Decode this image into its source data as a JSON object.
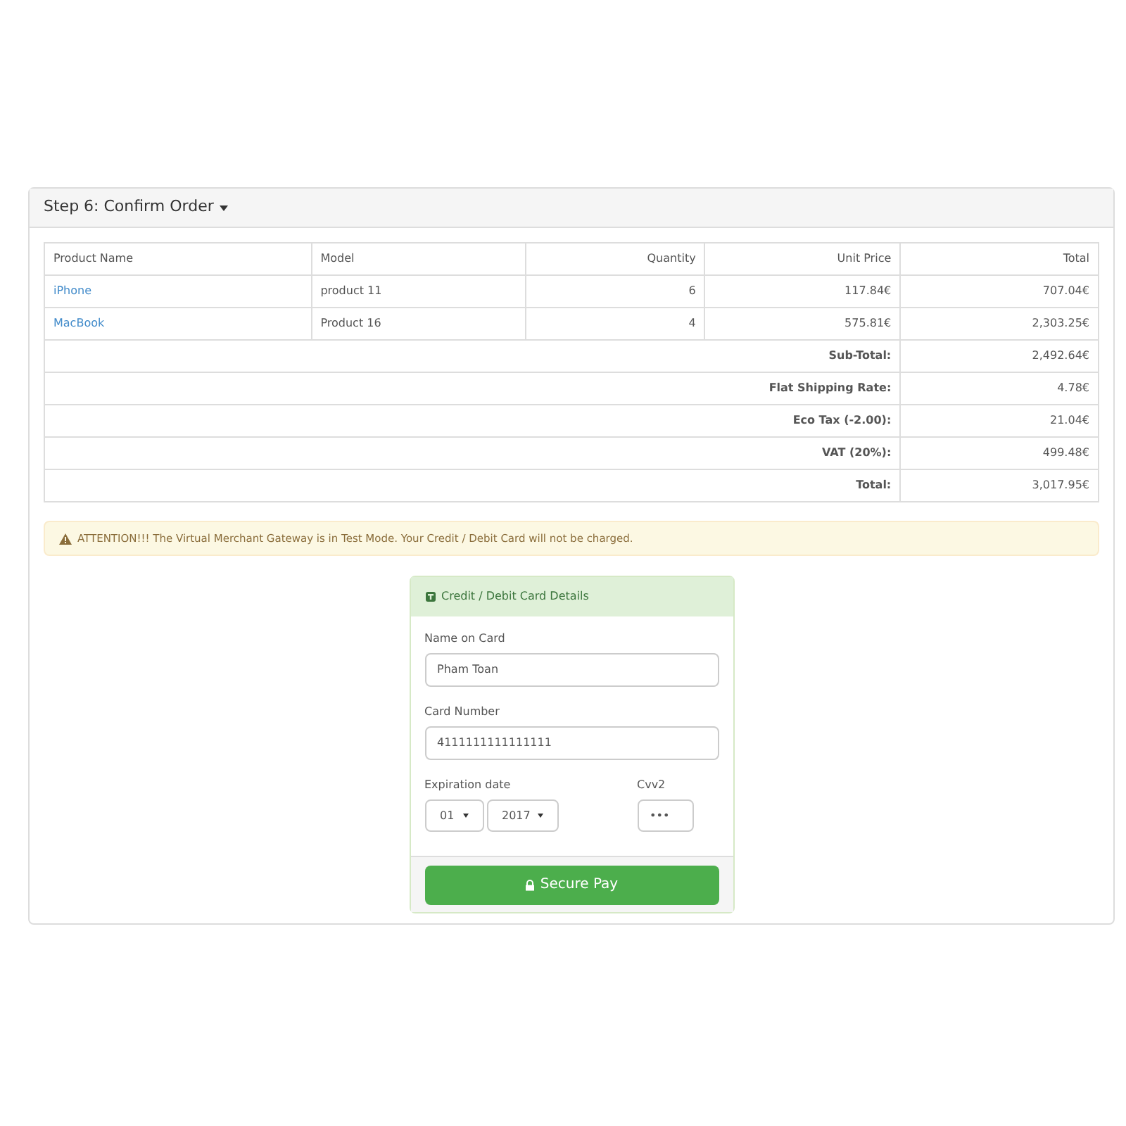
{
  "panel": {
    "title": "Step 6: Confirm Order"
  },
  "table": {
    "columns": [
      "Product Name",
      "Model",
      "Quantity",
      "Unit Price",
      "Total"
    ],
    "rows": [
      {
        "cells": [
          "iPhone",
          "product 11",
          "6",
          "117.84€",
          "707.04€"
        ]
      },
      {
        "cells": [
          "MacBook",
          "Product 16",
          "4",
          "575.81€",
          "2,303.25€"
        ]
      }
    ],
    "totals": [
      {
        "label": "Sub-Total:",
        "value": "2,492.64€"
      },
      {
        "label": "Flat Shipping Rate:",
        "value": "4.78€"
      },
      {
        "label": "Eco Tax (-2.00):",
        "value": "21.04€"
      },
      {
        "label": "VAT (20%):",
        "value": "499.48€"
      },
      {
        "label": "Total:",
        "value": "3,017.95€"
      }
    ]
  },
  "alert": {
    "text": "ATTENTION!!! The Virtual Merchant Gateway is in Test Mode. Your Credit / Debit Card will not be charged."
  },
  "card_form": {
    "title": "Credit / Debit Card Details",
    "name_label": "Name on Card",
    "name_value": "Pham Toan",
    "number_label": "Card Number",
    "number_value": "4111111111111111",
    "expiry_label": "Expiration date",
    "month": "01",
    "year": "2017",
    "cvv_label": "Cvv2",
    "cvv_value": "•••",
    "submit": "Secure Pay"
  }
}
